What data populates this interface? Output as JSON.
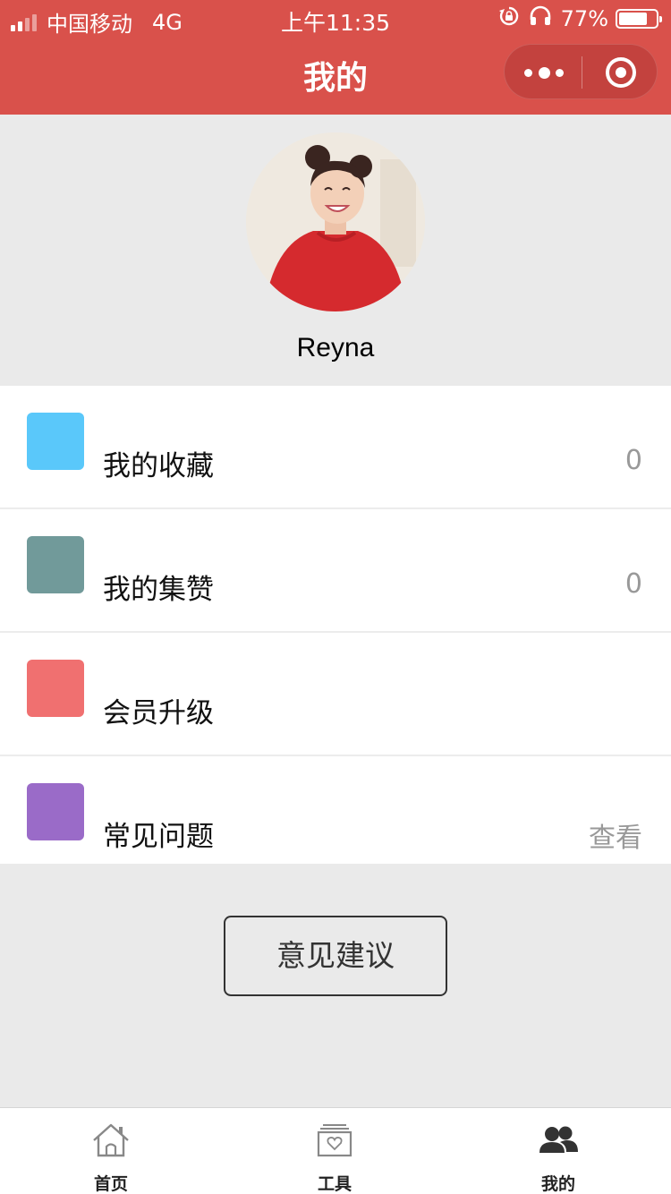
{
  "status_bar": {
    "carrier": "中国移动",
    "network": "4G",
    "time": "上午11:35",
    "battery_percent": "77%",
    "battery_level": 0.77
  },
  "nav": {
    "title": "我的",
    "header_color": "#d9514b"
  },
  "profile": {
    "username": "Reyna"
  },
  "menu": {
    "items": [
      {
        "label": "我的收藏",
        "value": "0",
        "color": "#5ac8fa"
      },
      {
        "label": "我的集赞",
        "value": "0",
        "color": "#719a9a"
      },
      {
        "label": "会员升级",
        "value": "",
        "color": "#f07070"
      },
      {
        "label": "常见问题",
        "value": "查看",
        "color": "#9a6bc8"
      }
    ]
  },
  "feedback": {
    "label": "意见建议"
  },
  "tabbar": {
    "tabs": [
      {
        "label": "首页",
        "icon": "home-icon"
      },
      {
        "label": "工具",
        "icon": "tools-icon"
      },
      {
        "label": "我的",
        "icon": "users-icon",
        "active": true
      }
    ]
  }
}
